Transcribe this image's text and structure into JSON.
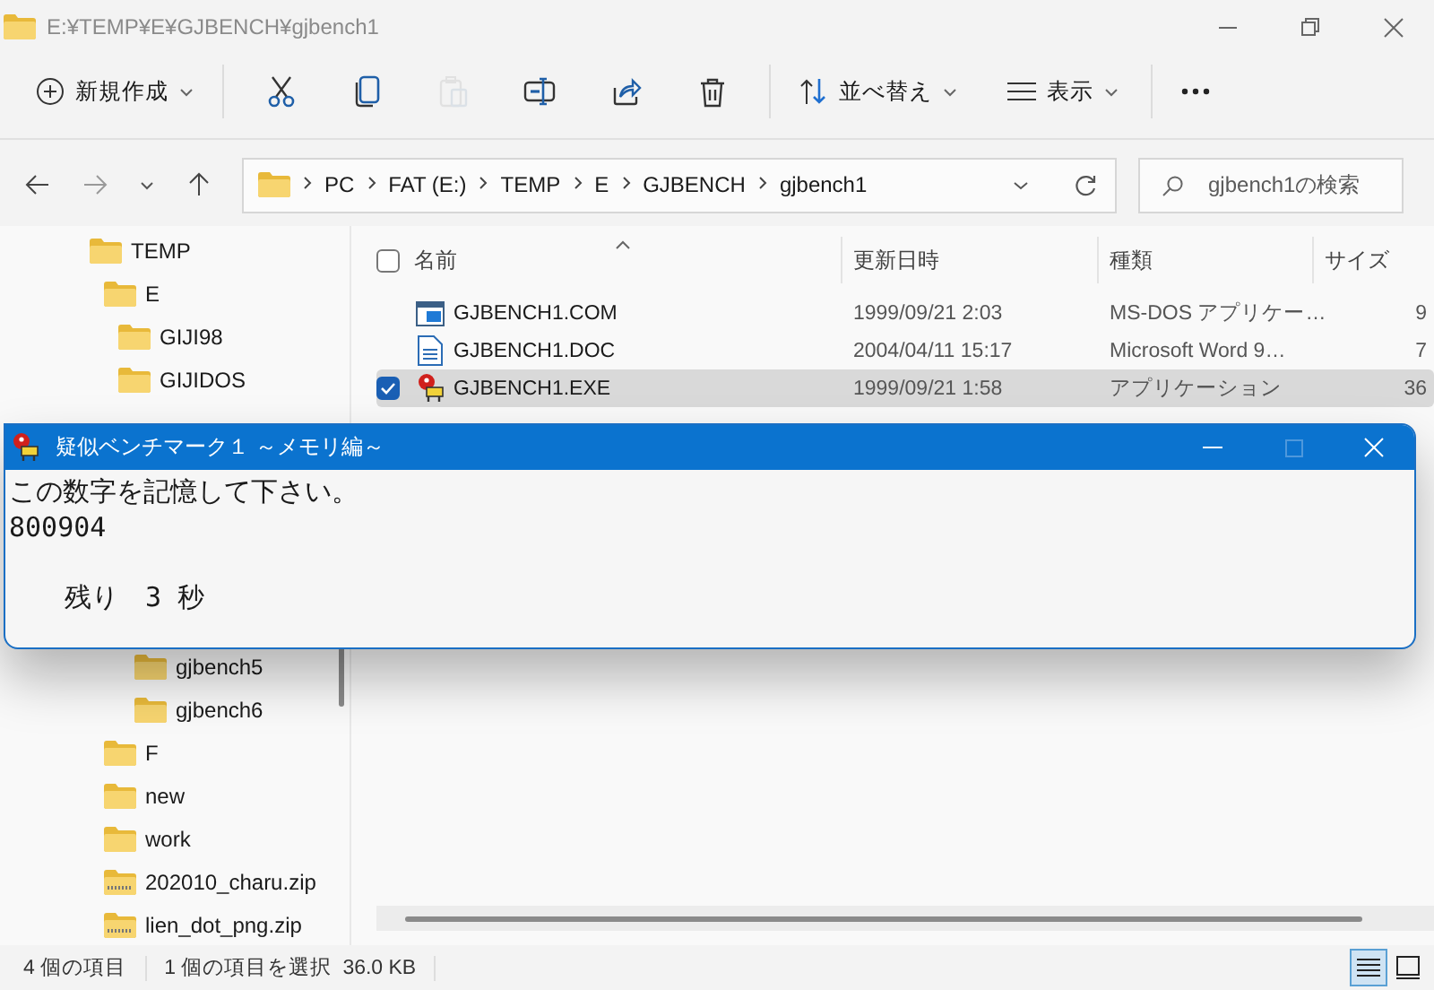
{
  "window": {
    "title": "E:¥TEMP¥E¥GJBENCH¥gjbench1",
    "active": false
  },
  "toolbar": {
    "new_button": "新規作成",
    "actions": [
      {
        "kind": "cut",
        "disabled": false
      },
      {
        "kind": "copy",
        "disabled": false
      },
      {
        "kind": "paste",
        "disabled": true
      },
      {
        "kind": "rename",
        "disabled": false
      },
      {
        "kind": "share",
        "disabled": false
      },
      {
        "kind": "delete",
        "disabled": false
      }
    ],
    "sort_button": "並べ替え",
    "view_button": "表示"
  },
  "address": {
    "crumbs": [
      "PC",
      "FAT (E:)",
      "TEMP",
      "E",
      "GJBENCH",
      "gjbench1"
    ]
  },
  "search": {
    "placeholder": "gjbench1の検索"
  },
  "sidebar": {
    "items": [
      {
        "label": "TEMP",
        "kind": "folder",
        "children": [
          {
            "label": "E",
            "kind": "folder",
            "children": [
              {
                "label": "GIJI98",
                "kind": "folder"
              },
              {
                "label": "GIJIDOS",
                "kind": "folder"
              },
              {
                "kind": "covered",
                "children": [
                  {
                    "label": "gjbench5",
                    "kind": "folder"
                  },
                  {
                    "label": "gjbench6",
                    "kind": "folder"
                  }
                ]
              }
            ]
          },
          {
            "label": "F",
            "kind": "folder"
          },
          {
            "label": "new",
            "kind": "folder"
          },
          {
            "label": "work",
            "kind": "folder"
          },
          {
            "label": "202010_charu.zip",
            "kind": "zip"
          },
          {
            "label": "lien_dot_png.zip",
            "kind": "zip"
          }
        ]
      }
    ]
  },
  "file_list": {
    "select_all": {
      "checked": false
    },
    "columns": [
      "名前",
      "更新日時",
      "種類",
      "サイズ"
    ],
    "rows": [
      {
        "name": "GJBENCH1.COM",
        "kind": "com",
        "modified": "1999/09/21 2:03",
        "type": "MS-DOS アプリケー…",
        "size": "9",
        "selected": false
      },
      {
        "name": "GJBENCH1.DOC",
        "kind": "doc",
        "modified": "2004/04/11 15:17",
        "type": "Microsoft Word 9…",
        "size": "7",
        "selected": false
      },
      {
        "name": "GJBENCH1.EXE",
        "kind": "exe",
        "modified": "1999/09/21 1:58",
        "type": "アプリケーション",
        "size": "36",
        "selected": true
      }
    ]
  },
  "status_bar": {
    "item_count": "4 個の項目",
    "selection": "1 個の項目を選択",
    "selection_size": "36.0 KB",
    "views": [
      {
        "kind": "details",
        "selected": true
      },
      {
        "kind": "tiles",
        "selected": false
      }
    ]
  },
  "dialog": {
    "title": "疑似ベンチマーク１ ～メモリ編～",
    "lines": [
      "この数字を記憶して下さい。",
      "800904"
    ],
    "countdown": "残り　3 秒"
  }
}
